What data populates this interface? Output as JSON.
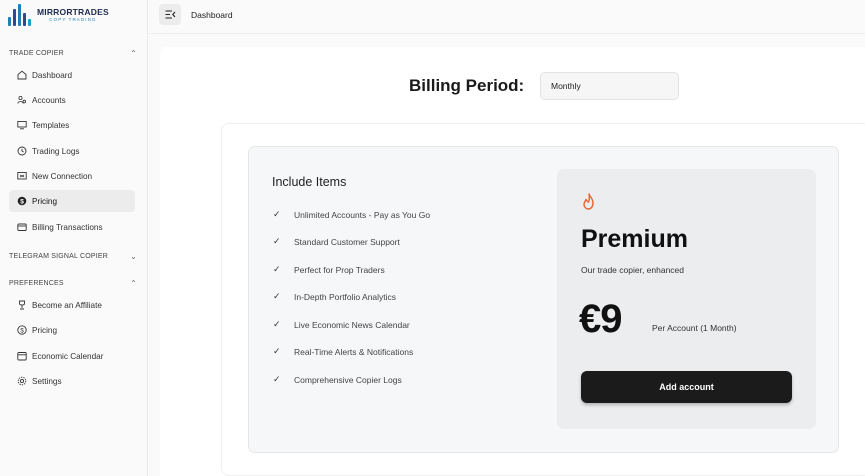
{
  "logo": {
    "main": "MIRRORTRADES",
    "sub": "COPY TRADING",
    "bar_colors": [
      "#1f7fb5",
      "#2d4a8c",
      "#1f7fb5",
      "#2d4a8c",
      "#18a0c9"
    ]
  },
  "sidebar": {
    "sections": [
      {
        "title": "TRADE COPIER",
        "chevron": "up"
      },
      {
        "title": "TELEGRAM SIGNAL COPIER",
        "chevron": "down"
      },
      {
        "title": "PREFERENCES",
        "chevron": "up"
      }
    ],
    "trade_items": [
      {
        "label": "Dashboard",
        "icon": "home-icon"
      },
      {
        "label": "Accounts",
        "icon": "users-icon"
      },
      {
        "label": "Templates",
        "icon": "monitor-icon"
      },
      {
        "label": "Trading Logs",
        "icon": "history-icon"
      },
      {
        "label": "New Connection",
        "icon": "connection-icon"
      },
      {
        "label": "Pricing",
        "icon": "dollar-circle-icon",
        "active": true
      },
      {
        "label": "Billing Transactions",
        "icon": "wallet-icon"
      }
    ],
    "pref_items": [
      {
        "label": "Become an Affiliate",
        "icon": "trophy-icon"
      },
      {
        "label": "Pricing",
        "icon": "dollar-outline-icon"
      },
      {
        "label": "Economic Calendar",
        "icon": "calendar-icon"
      },
      {
        "label": "Settings",
        "icon": "gear-icon"
      }
    ]
  },
  "topbar": {
    "breadcrumb": "Dashboard",
    "toggle_icon": "sidebar-toggle-icon"
  },
  "billing": {
    "label": "Billing Period:",
    "selected": "Monthly"
  },
  "plan": {
    "include_title": "Include Items",
    "features": [
      "Unlimited Accounts - Pay as You Go",
      "Standard Customer Support",
      "Perfect for Prop Traders",
      "In-Depth Portfolio Analytics",
      "Live Economic News Calendar",
      "Real-Time Alerts & Notifications",
      "Comprehensive Copier Logs"
    ],
    "name": "Premium",
    "subtitle": "Our trade copier, enhanced",
    "price": "€9",
    "price_note": "Per Account (1 Month)",
    "button": "Add account",
    "flame_color": "#e8622c"
  }
}
